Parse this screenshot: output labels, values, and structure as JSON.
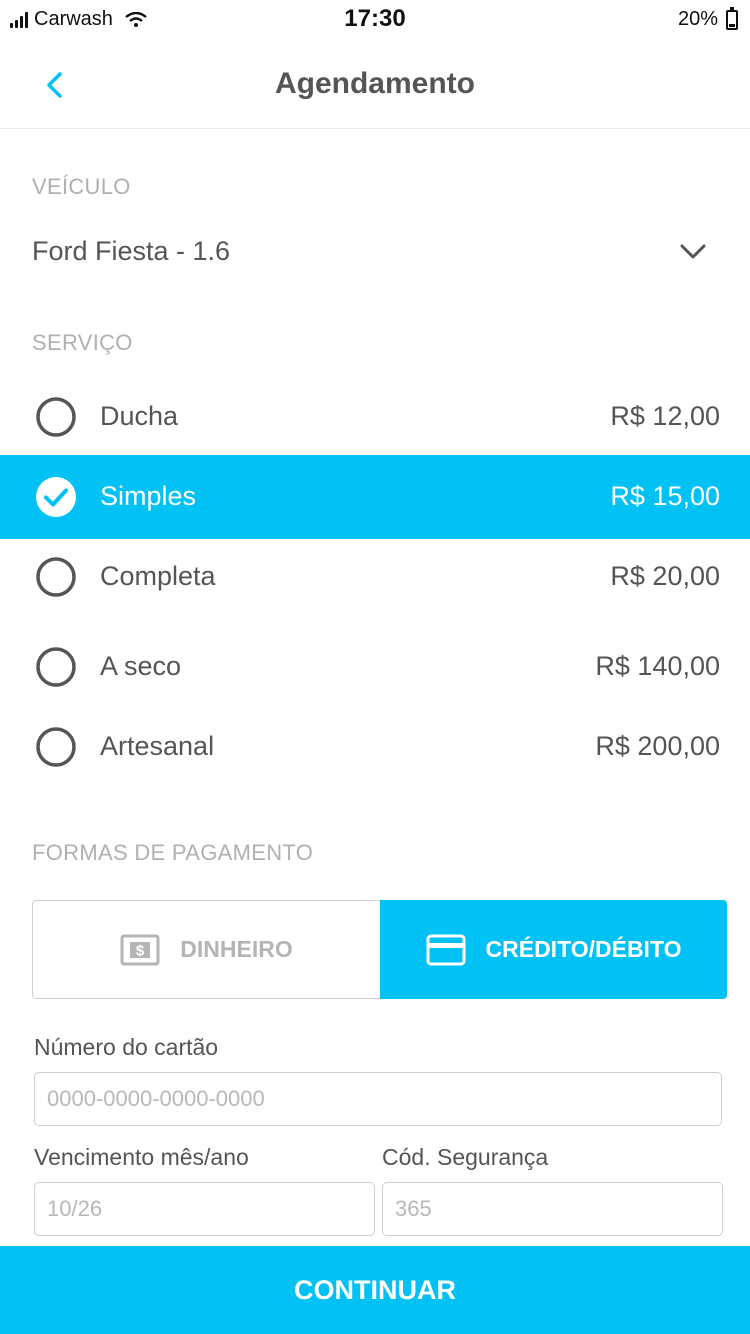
{
  "status_bar": {
    "carrier": "Carwash",
    "time": "17:30",
    "battery_percent": "20%",
    "battery_level": 0.2,
    "icons": [
      "signal-icon",
      "wifi-icon",
      "battery-icon"
    ]
  },
  "nav": {
    "title": "Agendamento",
    "back_icon": "chevron-left-icon"
  },
  "vehicle": {
    "label": "VEÍCULO",
    "selected": "Ford Fiesta - 1.6",
    "dropdown_icon": "chevron-down-icon"
  },
  "service": {
    "label": "SERVIÇO",
    "options": [
      {
        "name": "Ducha",
        "price": "R$ 12,00",
        "selected": false
      },
      {
        "name": "Simples",
        "price": "R$ 15,00",
        "selected": true
      },
      {
        "name": "Completa",
        "price": "R$ 20,00",
        "selected": false
      },
      {
        "name": "A seco",
        "price": "R$ 140,00",
        "selected": false
      },
      {
        "name": "Artesanal",
        "price": "R$ 200,00",
        "selected": false
      }
    ]
  },
  "payment": {
    "label": "FORMAS DE PAGAMENTO",
    "cash_label": "DINHEIRO",
    "card_label": "CRÉDITO/DÉBITO",
    "selected": "card",
    "cash_icon": "cash-icon",
    "card_icon": "credit-card-icon"
  },
  "card_form": {
    "number_label": "Número do cartão",
    "number_placeholder": "0000-0000-0000-0000",
    "expiry_label": "Vencimento mês/ano",
    "expiry_placeholder": "10/26",
    "cvv_label": "Cód. Segurança",
    "cvv_placeholder": "365"
  },
  "continue_label": "CONTINUAR",
  "colors": {
    "accent": "#02c1f4",
    "text": "#555555",
    "muted": "#b0b0b0",
    "border": "#cfcfcf"
  }
}
